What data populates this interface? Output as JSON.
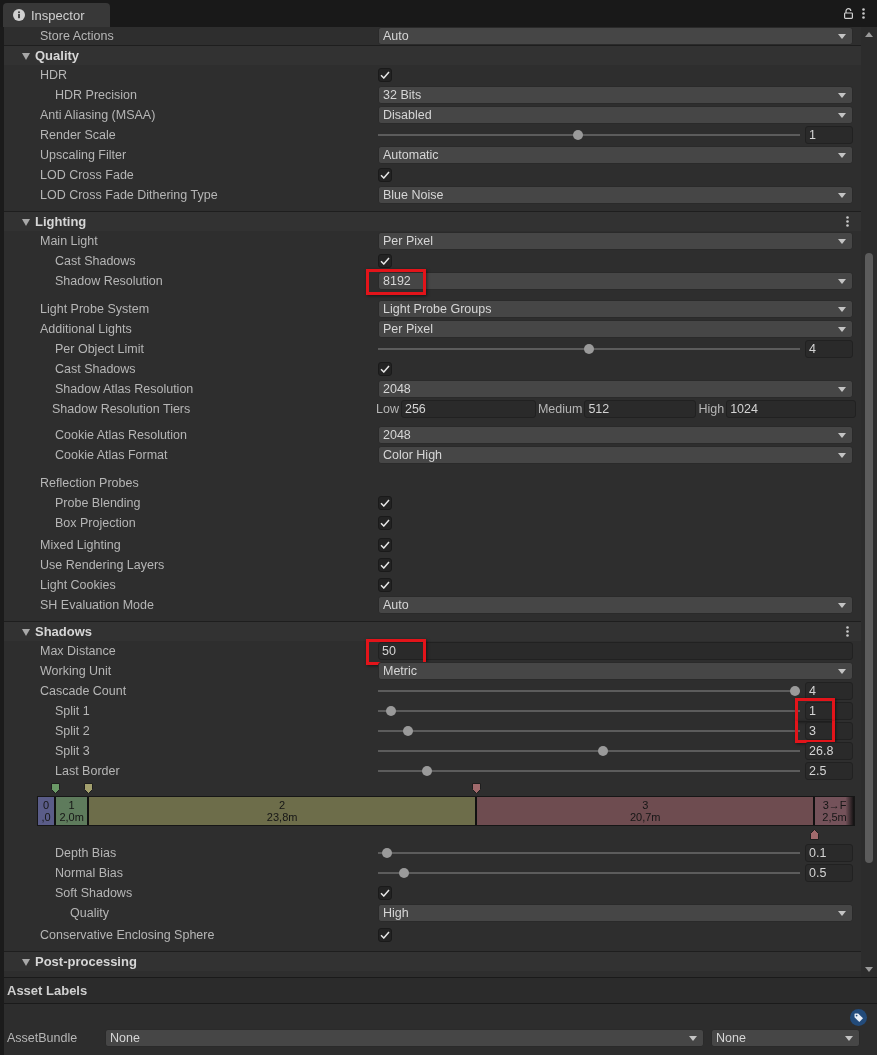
{
  "window": {
    "title": "Inspector"
  },
  "leading_rows": [
    {
      "label": "Store Actions",
      "kind": "dropdown",
      "value": "Auto"
    }
  ],
  "sections": [
    {
      "title": "Quality",
      "expanded": true,
      "menu": false,
      "rows": [
        {
          "label": "HDR",
          "kind": "checkbox",
          "checked": true,
          "children": [
            {
              "label": "HDR Precision",
              "kind": "dropdown",
              "value": "32 Bits"
            }
          ]
        },
        {
          "label": "Anti Aliasing (MSAA)",
          "kind": "dropdown",
          "value": "Disabled"
        },
        {
          "label": "Render Scale",
          "kind": "slider",
          "level": 0.473,
          "value": "1"
        },
        {
          "label": "Upscaling Filter",
          "kind": "dropdown",
          "value": "Automatic"
        },
        {
          "label": "LOD Cross Fade",
          "kind": "checkbox",
          "checked": true
        },
        {
          "label": "LOD Cross Fade Dithering Type",
          "kind": "dropdown",
          "value": "Blue Noise"
        }
      ]
    },
    {
      "title": "Lighting",
      "expanded": true,
      "menu": true,
      "rows": [
        {
          "label": "Main Light",
          "kind": "dropdown",
          "value": "Per Pixel",
          "children": [
            {
              "label": "Cast Shadows",
              "kind": "checkbox",
              "checked": true
            },
            {
              "label": "Shadow Resolution",
              "kind": "dropdown",
              "value": "8192",
              "highlighted": true
            }
          ]
        },
        {
          "label": "Light Probe System",
          "kind": "dropdown",
          "value": "Light Probe Groups"
        },
        {
          "label": "Additional Lights",
          "kind": "dropdown",
          "value": "Per Pixel",
          "children": [
            {
              "label": "Per Object Limit",
              "kind": "slider",
              "level": 0.5,
              "value": "4"
            },
            {
              "label": "Cast Shadows",
              "kind": "checkbox",
              "checked": true
            },
            {
              "label": "Shadow Atlas Resolution",
              "kind": "dropdown",
              "value": "2048"
            },
            {
              "label": "Shadow Resolution Tiers",
              "kind": "tiers",
              "tiers": [
                {
                  "label": "Low",
                  "value": "256"
                },
                {
                  "label": "Medium",
                  "value": "512"
                },
                {
                  "label": "High",
                  "value": "1024"
                }
              ]
            },
            {
              "label": "Cookie Atlas Resolution",
              "kind": "dropdown",
              "value": "2048"
            },
            {
              "label": "Cookie Atlas Format",
              "kind": "dropdown",
              "value": "Color High"
            }
          ]
        },
        {
          "label": "Reflection Probes",
          "kind": "heading",
          "children": [
            {
              "label": "Probe Blending",
              "kind": "checkbox",
              "checked": true
            },
            {
              "label": "Box Projection",
              "kind": "checkbox",
              "checked": true
            }
          ]
        },
        {
          "label": "Mixed Lighting",
          "kind": "checkbox",
          "checked": true
        },
        {
          "label": "Use Rendering Layers",
          "kind": "checkbox",
          "checked": true
        },
        {
          "label": "Light Cookies",
          "kind": "checkbox",
          "checked": true
        },
        {
          "label": "SH Evaluation Mode",
          "kind": "dropdown",
          "value": "Auto"
        }
      ]
    },
    {
      "title": "Shadows",
      "expanded": true,
      "menu": true,
      "rows": [
        {
          "label": "Max Distance",
          "kind": "text",
          "value": "50",
          "highlighted": true
        },
        {
          "label": "Working Unit",
          "kind": "dropdown",
          "value": "Metric"
        },
        {
          "label": "Cascade Count",
          "kind": "slider",
          "level": 1,
          "value": "4",
          "children": [
            {
              "label": "Split 1",
              "kind": "slider",
              "level": 0.02,
              "value": "1",
              "highlighted": true
            },
            {
              "label": "Split 2",
              "kind": "slider",
              "level": 0.06,
              "value": "3",
              "highlighted": true
            },
            {
              "label": "Split 3",
              "kind": "slider",
              "level": 0.535,
              "value": "26.8"
            },
            {
              "label": "Last Border",
              "kind": "slider",
              "level": 0.107,
              "value": "2.5"
            },
            {
              "kind": "cascade",
              "segments": [
                {
                  "kind": "split",
                  "index": "0",
                  "distance": ",0",
                  "color": "#5a5c88"
                },
                {
                  "kind": "split",
                  "index": "1",
                  "distance": "2,0m",
                  "color": "#5e7b5c",
                  "handle": {
                    "color": "#6a9966"
                  }
                },
                {
                  "kind": "split",
                  "index": "2",
                  "distance": "23,8m",
                  "color": "#6d6d4a",
                  "handle": {
                    "color": "#a3a06e"
                  }
                },
                {
                  "kind": "split",
                  "index": "3",
                  "distance": "20,7m",
                  "color": "#6e4c50",
                  "handle": {
                    "color": "#a06a6c"
                  }
                },
                {
                  "kind": "fallback",
                  "index": "3→F",
                  "distance": "2,5m",
                  "color": "#74525a",
                  "handle": {
                    "color": "#a06a6c"
                  }
                }
              ]
            },
            {
              "label": "Depth Bias",
              "kind": "slider",
              "level": 0.01,
              "value": "0.1"
            },
            {
              "label": "Normal Bias",
              "kind": "slider",
              "level": 0.05,
              "value": "0.5"
            },
            {
              "label": "Soft Shadows",
              "kind": "checkbox",
              "checked": true,
              "children": [
                {
                  "label": "Quality",
                  "kind": "dropdown",
                  "value": "High"
                }
              ]
            }
          ]
        },
        {
          "label": "Conservative Enclosing Sphere",
          "kind": "checkbox",
          "checked": true
        }
      ]
    },
    {
      "title": "Post-processing",
      "expanded": true,
      "menu": false
    }
  ],
  "asset_labels": {
    "title": "Asset Labels",
    "asset_bundle": {
      "label": "AssetBundle",
      "name": "None",
      "variant": "None"
    }
  }
}
